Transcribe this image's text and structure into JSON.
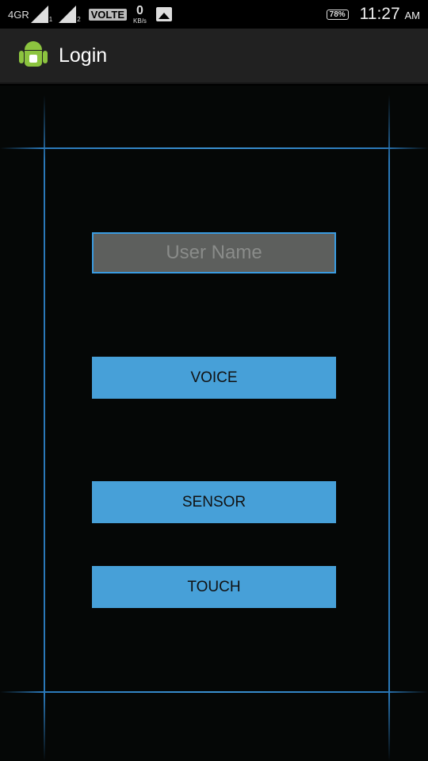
{
  "status_bar": {
    "network": "4GR",
    "sim1": "1",
    "sim2": "2",
    "volte": "VOLTE",
    "speed_value": "0",
    "speed_unit": "KB/s",
    "battery": "78%",
    "time": "11:27",
    "ampm": "AM"
  },
  "app_bar": {
    "title": "Login",
    "icon": "android-icon"
  },
  "form": {
    "username_value": "",
    "username_placeholder": "User Name",
    "voice_label": "VOICE",
    "sensor_label": "SENSOR",
    "touch_label": "TOUCH"
  },
  "colors": {
    "accent": "#47a0d8",
    "field_border": "#3a9be0",
    "app_bar": "#212121"
  }
}
